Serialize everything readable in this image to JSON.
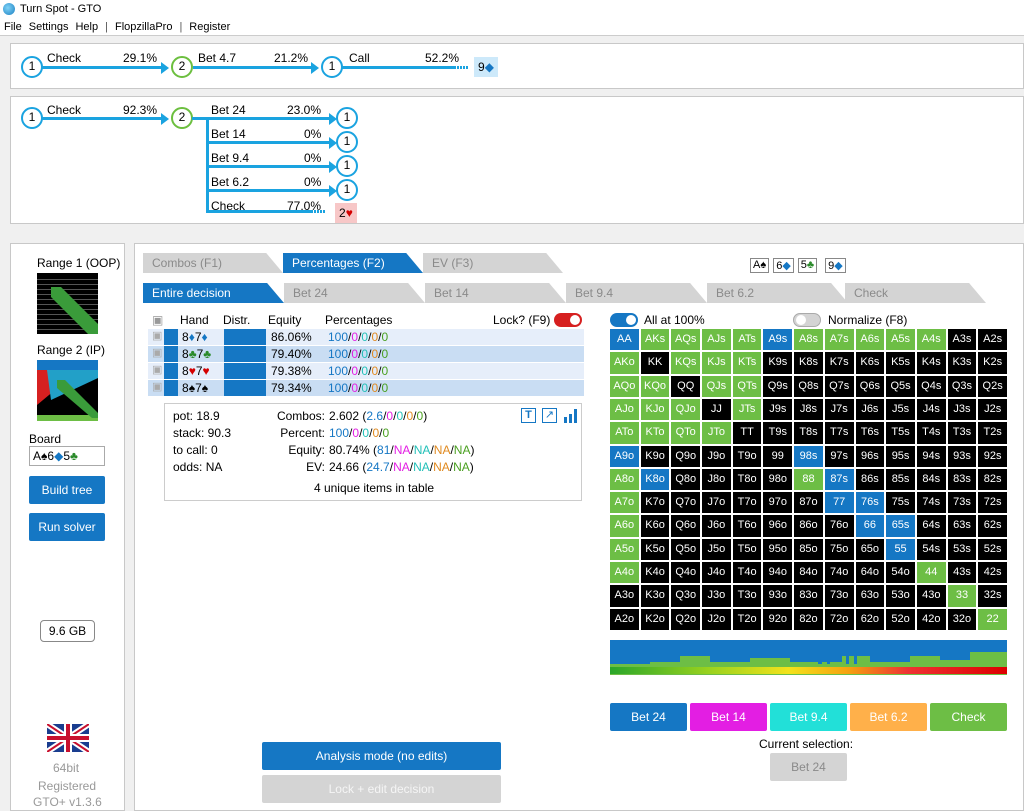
{
  "window": {
    "title": "Turn Spot - GTO"
  },
  "menu": [
    "File",
    "Settings",
    "Help",
    "|",
    "FlopzillaPro",
    "|",
    "Register"
  ],
  "line1": {
    "check_label": "Check",
    "check_pct": "29.1%",
    "bet_label": "Bet 4.7",
    "bet_pct": "21.2%",
    "call_label": "Call",
    "call_pct": "52.2%",
    "card": "9",
    "node_a": "1",
    "node_b": "2",
    "node_c": "1"
  },
  "line2": {
    "check_label": "Check",
    "check_pct": "92.3%",
    "node_a": "1",
    "node_b": "2",
    "branches": [
      {
        "label": "Bet 24",
        "pct": "23.0%",
        "node": "1"
      },
      {
        "label": "Bet 14",
        "pct": "0%",
        "node": "1"
      },
      {
        "label": "Bet 9.4",
        "pct": "0%",
        "node": "1"
      },
      {
        "label": "Bet 6.2",
        "pct": "0%",
        "node": "1"
      },
      {
        "label": "Check",
        "pct": "77.0%",
        "node": "2"
      }
    ]
  },
  "left": {
    "range1": "Range 1 (OOP)",
    "range2": "Range 2 (IP)",
    "board_label": "Board",
    "board": "A♠6♦5♣",
    "build": "Build tree",
    "run": "Run solver",
    "memory": "9.6 GB",
    "bit": "64bit",
    "registered": "Registered",
    "version": "GTO+ v1.3.6"
  },
  "tabs": {
    "main": [
      "Combos (F1)",
      "Percentages (F2)",
      "EV (F3)"
    ],
    "sub": [
      "Entire decision",
      "Bet 24",
      "Bet 14",
      "Bet 9.4",
      "Bet 6.2",
      "Check"
    ],
    "board_cards": [
      "A♠",
      "6♦",
      "5♣",
      "9♦"
    ]
  },
  "table": {
    "headers": {
      "hand": "Hand",
      "distr": "Distr.",
      "equity": "Equity",
      "pct": "Percentages",
      "lock": "Lock? (F9)"
    },
    "rows": [
      {
        "hand": "8♦7♦",
        "equity": "86.06%",
        "pct": "100/0/0/0/0"
      },
      {
        "hand": "8♣7♣",
        "equity": "79.40%",
        "pct": "100/0/0/0/0"
      },
      {
        "hand": "8♥7♥",
        "equity": "79.38%",
        "pct": "100/0/0/0/0"
      },
      {
        "hand": "8♠7♠",
        "equity": "79.34%",
        "pct": "100/0/0/0/0"
      }
    ]
  },
  "stats": {
    "pot": "pot: 18.9",
    "stack": "stack: 90.3",
    "tocall": "to call: 0",
    "odds": "odds: NA",
    "combos_label": "Combos:",
    "combos_val": "2.602",
    "combos_parts": [
      "2.6",
      "0",
      "0",
      "0",
      "0"
    ],
    "percent_label": "Percent:",
    "percent_parts": [
      "100",
      "0",
      "0",
      "0",
      "0"
    ],
    "equity_label": "Equity:",
    "equity_val": "80.74%",
    "equity_parts": [
      "81",
      "NA",
      "NA",
      "NA",
      "NA"
    ],
    "ev_label": "EV:",
    "ev_val": "24.66",
    "ev_parts": [
      "24.7",
      "NA",
      "NA",
      "NA",
      "NA"
    ],
    "unique": "4 unique items in table"
  },
  "options": {
    "all100": "All at 100%",
    "normalize": "Normalize (F8)"
  },
  "grid": {
    "cells": [
      [
        "AA",
        "AKs",
        "AQs",
        "AJs",
        "ATs",
        "A9s",
        "A8s",
        "A7s",
        "A6s",
        "A5s",
        "A4s",
        "A3s",
        "A2s"
      ],
      [
        "AKo",
        "KK",
        "KQs",
        "KJs",
        "KTs",
        "K9s",
        "K8s",
        "K7s",
        "K6s",
        "K5s",
        "K4s",
        "K3s",
        "K2s"
      ],
      [
        "AQo",
        "KQo",
        "QQ",
        "QJs",
        "QTs",
        "Q9s",
        "Q8s",
        "Q7s",
        "Q6s",
        "Q5s",
        "Q4s",
        "Q3s",
        "Q2s"
      ],
      [
        "AJo",
        "KJo",
        "QJo",
        "JJ",
        "JTs",
        "J9s",
        "J8s",
        "J7s",
        "J6s",
        "J5s",
        "J4s",
        "J3s",
        "J2s"
      ],
      [
        "ATo",
        "KTo",
        "QTo",
        "JTo",
        "TT",
        "T9s",
        "T8s",
        "T7s",
        "T6s",
        "T5s",
        "T4s",
        "T3s",
        "T2s"
      ],
      [
        "A9o",
        "K9o",
        "Q9o",
        "J9o",
        "T9o",
        "99",
        "98s",
        "97s",
        "96s",
        "95s",
        "94s",
        "93s",
        "92s"
      ],
      [
        "A8o",
        "K8o",
        "Q8o",
        "J8o",
        "T8o",
        "98o",
        "88",
        "87s",
        "86s",
        "85s",
        "84s",
        "83s",
        "82s"
      ],
      [
        "A7o",
        "K7o",
        "Q7o",
        "J7o",
        "T7o",
        "97o",
        "87o",
        "77",
        "76s",
        "75s",
        "74s",
        "73s",
        "72s"
      ],
      [
        "A6o",
        "K6o",
        "Q6o",
        "J6o",
        "T6o",
        "96o",
        "86o",
        "76o",
        "66",
        "65s",
        "64s",
        "63s",
        "62s"
      ],
      [
        "A5o",
        "K5o",
        "Q5o",
        "J5o",
        "T5o",
        "95o",
        "85o",
        "75o",
        "65o",
        "55",
        "54s",
        "53s",
        "52s"
      ],
      [
        "A4o",
        "K4o",
        "Q4o",
        "J4o",
        "T4o",
        "94o",
        "84o",
        "74o",
        "64o",
        "54o",
        "44",
        "43s",
        "42s"
      ],
      [
        "A3o",
        "K3o",
        "Q3o",
        "J3o",
        "T3o",
        "93o",
        "83o",
        "73o",
        "63o",
        "53o",
        "43o",
        "33",
        "32s"
      ],
      [
        "A2o",
        "K2o",
        "Q2o",
        "J2o",
        "T2o",
        "92o",
        "82o",
        "72o",
        "62o",
        "52o",
        "42o",
        "32o",
        "22"
      ]
    ],
    "colors": [
      [
        "b",
        "g",
        "g",
        "g",
        "g",
        "b",
        "g",
        "g",
        "g",
        "g",
        "g",
        "k",
        "k"
      ],
      [
        "g",
        "k",
        "g",
        "g",
        "g",
        "k",
        "k",
        "k",
        "k",
        "k",
        "k",
        "k",
        "k"
      ],
      [
        "g",
        "g",
        "k",
        "g",
        "g",
        "k",
        "k",
        "k",
        "k",
        "k",
        "k",
        "k",
        "k"
      ],
      [
        "g",
        "g",
        "g",
        "k",
        "g",
        "k",
        "k",
        "k",
        "k",
        "k",
        "k",
        "k",
        "k"
      ],
      [
        "g",
        "g",
        "g",
        "g",
        "k",
        "k",
        "k",
        "k",
        "k",
        "k",
        "k",
        "k",
        "k"
      ],
      [
        "b",
        "k",
        "k",
        "k",
        "k",
        "k",
        "b",
        "k",
        "k",
        "k",
        "k",
        "k",
        "k"
      ],
      [
        "g",
        "b",
        "k",
        "k",
        "k",
        "k",
        "g",
        "b",
        "k",
        "k",
        "k",
        "k",
        "k"
      ],
      [
        "g",
        "k",
        "k",
        "k",
        "k",
        "k",
        "k",
        "b",
        "b",
        "k",
        "k",
        "k",
        "k"
      ],
      [
        "g",
        "k",
        "k",
        "k",
        "k",
        "k",
        "k",
        "k",
        "b",
        "b",
        "k",
        "k",
        "k"
      ],
      [
        "g",
        "k",
        "k",
        "k",
        "k",
        "k",
        "k",
        "k",
        "k",
        "b",
        "k",
        "k",
        "k"
      ],
      [
        "g",
        "k",
        "k",
        "k",
        "k",
        "k",
        "k",
        "k",
        "k",
        "k",
        "g",
        "k",
        "k"
      ],
      [
        "k",
        "k",
        "k",
        "k",
        "k",
        "k",
        "k",
        "k",
        "k",
        "k",
        "k",
        "g",
        "k"
      ],
      [
        "k",
        "k",
        "k",
        "k",
        "k",
        "k",
        "k",
        "k",
        "k",
        "k",
        "k",
        "k",
        "g"
      ]
    ]
  },
  "actions": [
    {
      "label": "Bet 24",
      "color": "#1577c4",
      "text": "#ffffff"
    },
    {
      "label": "Bet 14",
      "color": "#e31ee3",
      "text": "#ffffff"
    },
    {
      "label": "Bet 9.4",
      "color": "#22e0d8",
      "text": "#ffffff"
    },
    {
      "label": "Bet 6.2",
      "color": "#ffb04a",
      "text": "#ffffff"
    },
    {
      "label": "Check",
      "color": "#6dbe45",
      "text": "#ffffff"
    }
  ],
  "selection": {
    "label": "Current selection:",
    "value": "Bet 24"
  },
  "bottom": {
    "analysis": "Analysis mode (no edits)",
    "lock_edit": "Lock + edit decision"
  },
  "colors": {
    "blue": "#1577c4",
    "green": "#6dbe45",
    "black": "#000000",
    "line": "#1aa3e0",
    "red": "#d9534f"
  }
}
